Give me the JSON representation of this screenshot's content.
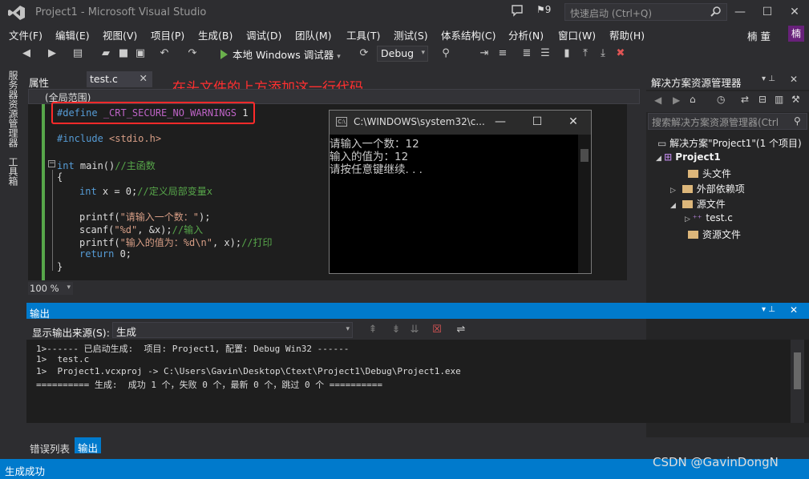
{
  "window": {
    "title": "Project1 - Microsoft Visual Studio",
    "notification_count": "9",
    "quick_launch_placeholder": "快速启动 (Ctrl+Q)",
    "minimize": "—",
    "maximize": "☐",
    "close": "✕"
  },
  "menu": {
    "items": [
      "文件(F)",
      "编辑(E)",
      "视图(V)",
      "项目(P)",
      "生成(B)",
      "调试(D)",
      "团队(M)",
      "工具(T)",
      "测试(S)",
      "体系结构(C)",
      "分析(N)",
      "窗口(W)",
      "帮助(H)"
    ]
  },
  "user": {
    "name": "楠 董",
    "initial": "楠"
  },
  "toolbar": {
    "run_label": "本地 Windows 调试器",
    "configuration": "Debug"
  },
  "left_rail": {
    "tabs": [
      "服务器资源管理器",
      "工具箱"
    ]
  },
  "editor": {
    "properties_tab": "属性",
    "document_tab": "test.c",
    "scope": "(全局范围)",
    "zoom": "100 %",
    "annotation": "在头文件的上方添加这一行代码",
    "code": {
      "l1_directive": "#define",
      "l1_macro": "_CRT_SECURE_NO_WARNINGS",
      "l1_value": "1",
      "l2_directive": "#include",
      "l2_header": "<stdio.h>",
      "l3_type": "int",
      "l3_rest": " main()",
      "l3_comment": "//主函数",
      "l4": "{",
      "l5_type": "int",
      "l5_rest": " x = 0;",
      "l5_comment": "//定义局部变量x",
      "l6_fn": "printf(",
      "l6_str": "\"请输入一个数：\"",
      "l6_end": ");",
      "l7_fn": "scanf(",
      "l7_str": "\"%d\"",
      "l7_end": ", &x);",
      "l7_comment": "//输入",
      "l8_fn": "printf(",
      "l8_str": "\"输入的值为：%d\\n\"",
      "l8_end": ", x);",
      "l8_comment": "//打印",
      "l9_kw": "return",
      "l9_rest": " 0;",
      "l10": "}"
    }
  },
  "console": {
    "title": "C:\\WINDOWS\\system32\\c...",
    "lines": [
      "请输入一个数：12",
      "输入的值为：12",
      "请按任意键继续. . ."
    ]
  },
  "solution_explorer": {
    "title": "解决方案资源管理器",
    "search_placeholder": "搜索解决方案资源管理器(Ctrl",
    "solution": "解决方案\"Project1\"(1 个项目)",
    "project": "Project1",
    "items": [
      "头文件",
      "外部依赖项",
      "源文件",
      "test.c",
      "资源文件"
    ]
  },
  "output": {
    "title": "输出",
    "source_label": "显示输出来源(S):",
    "source_value": "生成",
    "lines": [
      "1>------ 已启动生成:  项目: Project1, 配置: Debug Win32 ------",
      "1>  test.c",
      "1>  Project1.vcxproj -> C:\\Users\\Gavin\\Desktop\\Ctext\\Project1\\Debug\\Project1.exe",
      "========== 生成:  成功 1 个，失败 0 个，最新 0 个，跳过 0 个 =========="
    ]
  },
  "bottom_tabs": {
    "errors": "错误列表",
    "output": "输出"
  },
  "status": {
    "text": "生成成功"
  },
  "watermark": "CSDN @GavinDongN"
}
